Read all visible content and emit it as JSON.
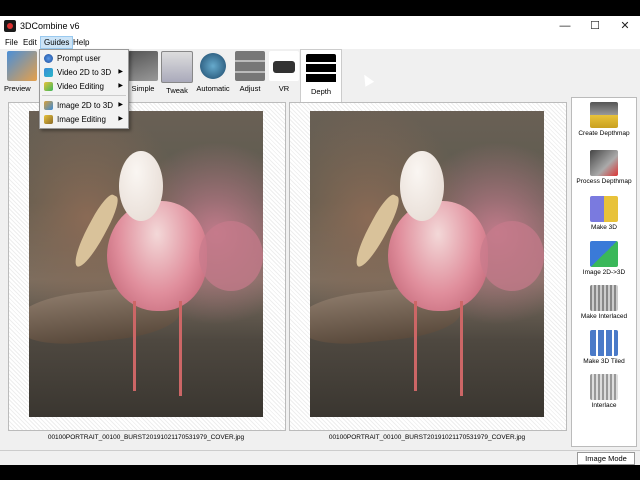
{
  "window": {
    "title": "3DCombine v6"
  },
  "window_controls": {
    "minimize": "—",
    "maximize": "☐",
    "close": "✕"
  },
  "menu": [
    "File",
    "Edit",
    "Guides",
    "Help"
  ],
  "toolbar": {
    "preview_label": "Preview",
    "items": [
      "Simple",
      "Tweak",
      "Automatic",
      "Adjust",
      "VR",
      "Depth"
    ]
  },
  "guides_menu": {
    "items": [
      {
        "label": "Prompt user",
        "submenu": false,
        "icon": "globe-icon"
      },
      {
        "label": "Video 2D to 3D",
        "submenu": true,
        "icon": "pen-icon"
      },
      {
        "label": "Video Editing",
        "submenu": true,
        "icon": "film-icon"
      },
      {
        "label": "Image 2D to 3D",
        "submenu": true,
        "icon": "image-icon"
      },
      {
        "label": "Image Editing",
        "submenu": true,
        "icon": "brush-icon"
      }
    ],
    "submenu_arrow": "▶"
  },
  "left_panel": {
    "caption": "00100PORTRAIT_00100_BURST20191021170531979_COVER.jpg"
  },
  "right_panel": {
    "caption": "00100PORTRAIT_00100_BURST20191021170531979_COVER.jpg"
  },
  "sidebar": {
    "items": [
      "Create Depthmap",
      "Process Depthmap",
      "Make 3D",
      "Image 2D->3D",
      "Make Interlaced",
      "Make 3D Tiled",
      "Interlace"
    ]
  },
  "status": {
    "mode": "Image Mode"
  }
}
